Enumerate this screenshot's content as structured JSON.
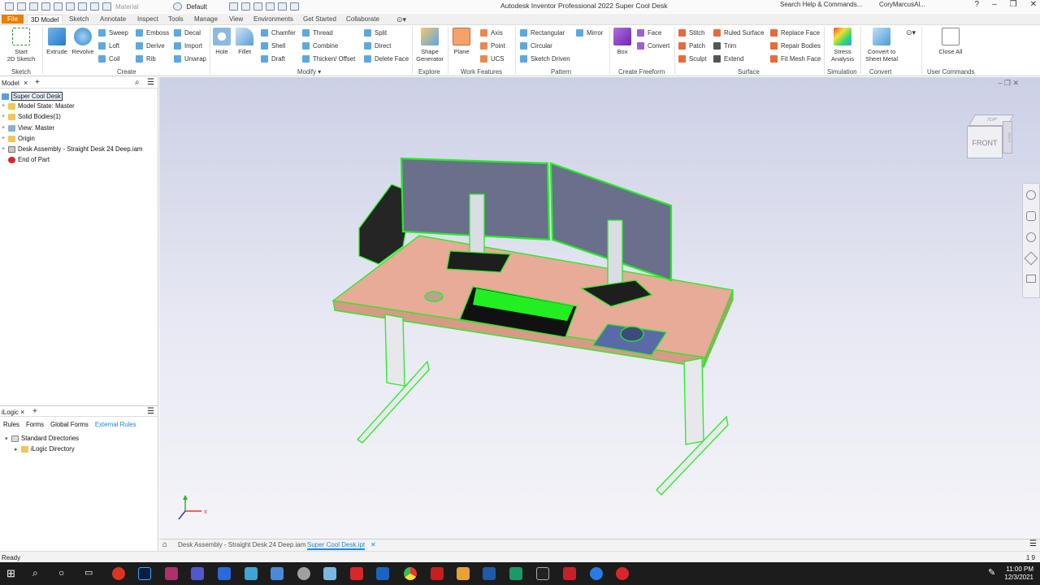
{
  "window": {
    "title": "Autodesk Inventor Professional 2022   Super Cool Desk",
    "search_placeholder": "Search Help & Commands...",
    "user": "CoryMarcusAl...",
    "qat_material": "Material",
    "qat_appearance": "Default"
  },
  "ribbon_tabs": [
    {
      "label": "File"
    },
    {
      "label": "3D Model"
    },
    {
      "label": "Sketch"
    },
    {
      "label": "Annotate"
    },
    {
      "label": "Inspect"
    },
    {
      "label": "Tools"
    },
    {
      "label": "Manage"
    },
    {
      "label": "View"
    },
    {
      "label": "Environments"
    },
    {
      "label": "Get Started"
    },
    {
      "label": "Collaborate"
    }
  ],
  "ribbon": {
    "sketch": {
      "start": "Start",
      "start2": "2D Sketch",
      "group": "Sketch"
    },
    "create": {
      "extrude": "Extrude",
      "revolve": "Revolve",
      "sweep": "Sweep",
      "emboss": "Emboss",
      "decal": "Decal",
      "loft": "Loft",
      "derive": "Derive",
      "import": "Import",
      "coil": "Coil",
      "rib": "Rib",
      "unwrap": "Unwrap",
      "group": "Create"
    },
    "modify": {
      "hole": "Hole",
      "fillet": "Fillet",
      "chamfer": "Chamfer",
      "thread": "Thread",
      "split": "Split",
      "shell": "Shell",
      "combine": "Combine",
      "direct": "Direct",
      "draft": "Draft",
      "thicken": "Thicken/ Offset",
      "delete_face": "Delete Face",
      "group": "Modify ▾"
    },
    "explore": {
      "shape": "Shape",
      "generator": "Generator",
      "group": "Explore"
    },
    "work": {
      "plane": "Plane",
      "axis": "Axis",
      "point": "Point",
      "ucs": "UCS",
      "group": "Work Features"
    },
    "pattern": {
      "rectangular": "Rectangular",
      "mirror": "Mirror",
      "circular": "Circular",
      "sketch_driven": "Sketch Driven",
      "group": "Pattern"
    },
    "freeform": {
      "box": "Box",
      "face": "Face",
      "convert": "Convert",
      "group": "Create Freeform"
    },
    "surface": {
      "stitch": "Stitch",
      "ruled": "Ruled Surface",
      "replace": "Replace Face",
      "patch": "Patch",
      "trim": "Trim",
      "repair": "Repair Bodies",
      "sculpt": "Sculpt",
      "extend": "Extend",
      "fit": "Fit Mesh Face",
      "group": "Surface"
    },
    "simulation": {
      "stress": "Stress",
      "analysis": "Analysis",
      "group": "Simulation"
    },
    "convert": {
      "to_sheet": "Convert to",
      "sheet_metal": "Sheet Metal",
      "group": "Convert"
    },
    "user": {
      "close_all": "Close All",
      "group": "User Commands"
    }
  },
  "browser": {
    "tab": "Model",
    "tree": [
      {
        "label": "Super Cool Desk"
      },
      {
        "label": "Model State: Master"
      },
      {
        "label": "Solid Bodies(1)"
      },
      {
        "label": "View: Master"
      },
      {
        "label": "Origin"
      },
      {
        "label": "Desk Assembly - Straight Desk 24 Deep.iam"
      },
      {
        "label": "End of Part"
      }
    ]
  },
  "ilogic": {
    "tab": "iLogic",
    "subtabs": [
      "Rules",
      "Forms",
      "Global Forms",
      "External Rules"
    ],
    "tree": [
      {
        "label": "Standard Directories"
      },
      {
        "label": "iLogic Directory"
      }
    ]
  },
  "viewcube": {
    "top": "TOP",
    "front": "FRONT",
    "right": "RIGHT"
  },
  "doc_tabs": [
    {
      "label": "Desk Assembly - Straight Desk 24 Deep.iam"
    },
    {
      "label": "Super Cool Desk.ipt"
    }
  ],
  "status": {
    "text": "Ready",
    "counts": "1   9"
  },
  "clock": {
    "time": "11:00 PM",
    "date": "12/3/2021"
  },
  "colors": {
    "accent": "#e87f00",
    "highlight": "#22ff22",
    "desk_top": "#e6a894",
    "active_tab": "#1a8ad6"
  }
}
